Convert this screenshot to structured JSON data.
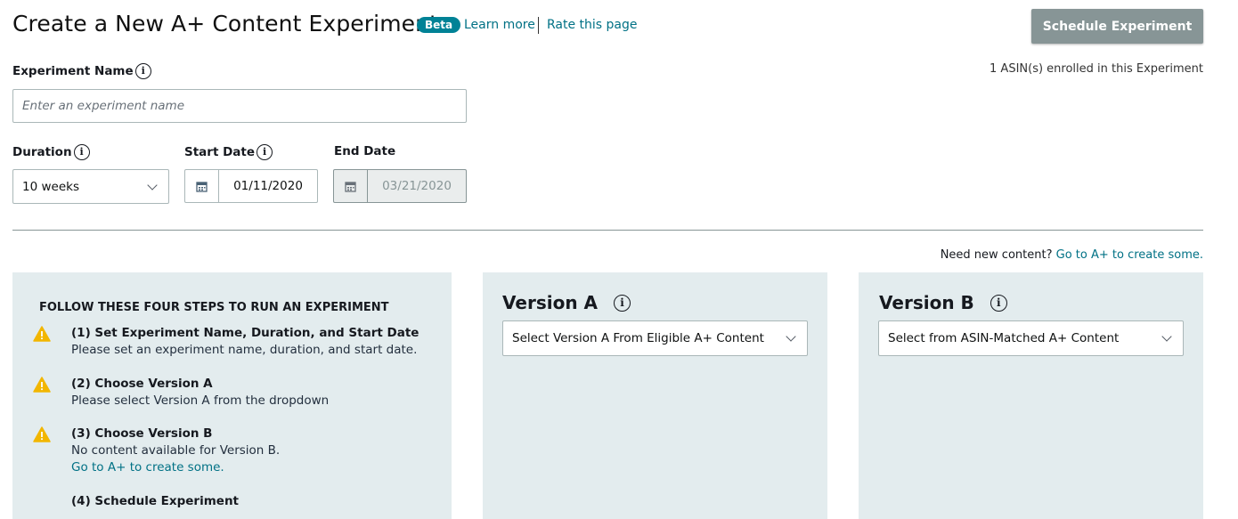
{
  "header": {
    "title": "Create a New A+ Content Experiment",
    "badge": "Beta",
    "learn_more": "Learn more",
    "rate_page": "Rate this page",
    "schedule_button": "Schedule Experiment",
    "asin_enrolled": "1 ASIN(s) enrolled in this Experiment"
  },
  "form": {
    "name_label": "Experiment Name",
    "name_placeholder": "Enter an experiment name",
    "name_value": "",
    "duration_label": "Duration",
    "duration_value": "10 weeks",
    "start_label": "Start Date",
    "start_value": "01/11/2020",
    "end_label": "End Date",
    "end_value": "03/21/2020"
  },
  "content_note": {
    "text": "Need new content?",
    "link": "Go to A+ to create some."
  },
  "steps": {
    "title": "FOLLOW THESE FOUR STEPS TO RUN AN EXPERIMENT",
    "items": [
      {
        "heading": "(1) Set Experiment Name, Duration, and Start Date",
        "detail": "Please set an experiment name, duration, and start date.",
        "status": "warning"
      },
      {
        "heading": "(2) Choose Version A",
        "detail": "Please select Version A from the dropdown",
        "status": "warning"
      },
      {
        "heading": "(3) Choose Version B",
        "detail": "No content available for Version B.",
        "link": "Go to A+ to create some.",
        "status": "warning"
      },
      {
        "heading": "(4) Schedule Experiment",
        "status": "none"
      }
    ]
  },
  "version_a": {
    "title": "Version A",
    "select_value": "Select Version A From Eligible A+ Content"
  },
  "version_b": {
    "title": "Version B",
    "select_value": "Select from ASIN-Matched A+ Content"
  },
  "colors": {
    "accent": "#008296",
    "link": "#007185",
    "warning": "#f2b600",
    "panel": "#e3ecee",
    "button_disabled": "#879596"
  },
  "icons": {
    "info": "info-icon",
    "calendar": "calendar-icon",
    "warning": "warning-icon",
    "chevron": "chevron-down-icon"
  }
}
